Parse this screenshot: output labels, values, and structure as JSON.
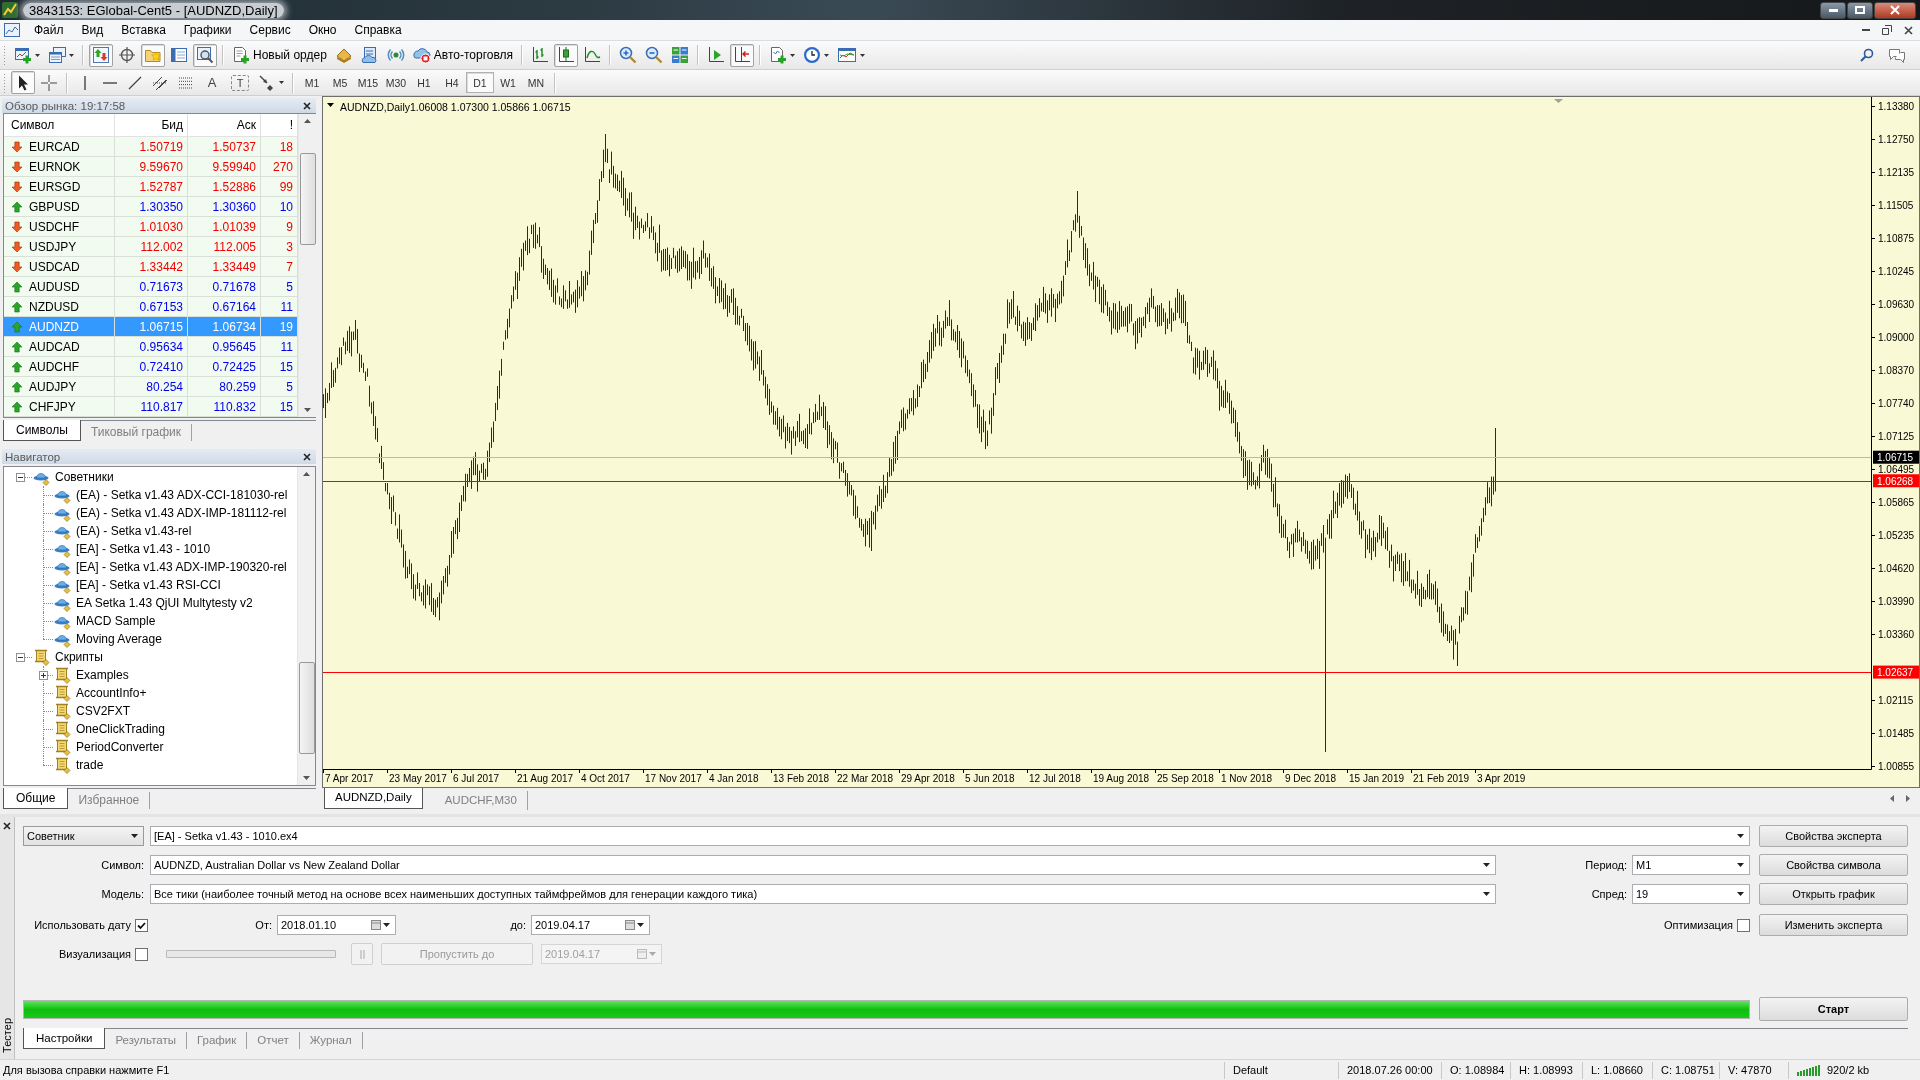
{
  "window": {
    "title": "3843153: EGlobal-Cent5 - [AUDNZD,Daily]"
  },
  "menu": [
    "Файл",
    "Вид",
    "Вставка",
    "Графики",
    "Сервис",
    "Окно",
    "Справка"
  ],
  "toolbar": [
    {
      "kind": "new-chart",
      "on": false
    },
    {
      "kind": "profiles",
      "on": false
    },
    {
      "kind": "separator"
    },
    {
      "kind": "market-watch",
      "on": true
    },
    {
      "kind": "data-window",
      "on": false
    },
    {
      "kind": "navigator",
      "on": true
    },
    {
      "kind": "terminal",
      "on": false
    },
    {
      "kind": "tester",
      "on": true
    },
    {
      "kind": "separator"
    },
    {
      "kind": "new-order",
      "label": "Новый ордер",
      "on": false
    },
    {
      "kind": "editor",
      "on": false
    },
    {
      "kind": "signals",
      "on": false
    },
    {
      "kind": "market",
      "on": false
    },
    {
      "kind": "auto-trading",
      "label": "Авто-торговля",
      "on": false
    },
    {
      "kind": "separator"
    },
    {
      "kind": "bar-chart",
      "on": false
    },
    {
      "kind": "candles",
      "on": true
    },
    {
      "kind": "line-chart",
      "on": false
    },
    {
      "kind": "separator"
    },
    {
      "kind": "zoom-in",
      "on": false
    },
    {
      "kind": "zoom-out",
      "on": false
    },
    {
      "kind": "tile",
      "on": false
    },
    {
      "kind": "separator"
    },
    {
      "kind": "auto-scroll",
      "on": false
    },
    {
      "kind": "chart-shift",
      "on": true
    },
    {
      "kind": "separator"
    },
    {
      "kind": "indicators",
      "on": false
    },
    {
      "kind": "periods",
      "on": false
    },
    {
      "kind": "templates",
      "on": false
    }
  ],
  "drawing_tools": [
    {
      "kind": "cursor",
      "on": true
    },
    {
      "kind": "crosshair",
      "on": false
    },
    {
      "kind": "separator"
    },
    {
      "kind": "vertical-line",
      "on": false
    },
    {
      "kind": "horizontal-line",
      "on": false
    },
    {
      "kind": "trend-line",
      "on": false
    },
    {
      "kind": "channel",
      "on": false
    },
    {
      "kind": "fibonacci",
      "on": false
    },
    {
      "kind": "text",
      "label": "A",
      "on": false
    },
    {
      "kind": "text-label",
      "label": "T",
      "on": false
    },
    {
      "kind": "arrows",
      "on": false
    }
  ],
  "periods": [
    {
      "label": "M1",
      "selected": false
    },
    {
      "label": "M5",
      "selected": false
    },
    {
      "label": "M15",
      "selected": false
    },
    {
      "label": "M30",
      "selected": false
    },
    {
      "label": "H1",
      "selected": false
    },
    {
      "label": "H4",
      "selected": false
    },
    {
      "label": "D1",
      "selected": true
    },
    {
      "label": "W1",
      "selected": false
    },
    {
      "label": "MN",
      "selected": false
    }
  ],
  "market_watch": {
    "title": "Обзор рынка: 19:17:58",
    "columns": [
      "Символ",
      "Бид",
      "Аск",
      "!"
    ],
    "rows": [
      {
        "symbol": "EURCAD",
        "bid": "1.50719",
        "ask": "1.50737",
        "spread": "18",
        "kind": "down",
        "selected": false
      },
      {
        "symbol": "EURNOK",
        "bid": "9.59670",
        "ask": "9.59940",
        "spread": "270",
        "kind": "down",
        "selected": false
      },
      {
        "symbol": "EURSGD",
        "bid": "1.52787",
        "ask": "1.52886",
        "spread": "99",
        "kind": "down",
        "selected": false
      },
      {
        "symbol": "GBPUSD",
        "bid": "1.30350",
        "ask": "1.30360",
        "spread": "10",
        "kind": "up",
        "selected": false
      },
      {
        "symbol": "USDCHF",
        "bid": "1.01030",
        "ask": "1.01039",
        "spread": "9",
        "kind": "down",
        "selected": false
      },
      {
        "symbol": "USDJPY",
        "bid": "112.002",
        "ask": "112.005",
        "spread": "3",
        "kind": "down",
        "selected": false
      },
      {
        "symbol": "USDCAD",
        "bid": "1.33442",
        "ask": "1.33449",
        "spread": "7",
        "kind": "down",
        "selected": false
      },
      {
        "symbol": "AUDUSD",
        "bid": "0.71673",
        "ask": "0.71678",
        "spread": "5",
        "kind": "up",
        "selected": false
      },
      {
        "symbol": "NZDUSD",
        "bid": "0.67153",
        "ask": "0.67164",
        "spread": "11",
        "kind": "up",
        "selected": false
      },
      {
        "symbol": "AUDNZD",
        "bid": "1.06715",
        "ask": "1.06734",
        "spread": "19",
        "kind": "up",
        "selected": true
      },
      {
        "symbol": "AUDCAD",
        "bid": "0.95634",
        "ask": "0.95645",
        "spread": "11",
        "kind": "up",
        "selected": false
      },
      {
        "symbol": "AUDCHF",
        "bid": "0.72410",
        "ask": "0.72425",
        "spread": "15",
        "kind": "up",
        "selected": false
      },
      {
        "symbol": "AUDJPY",
        "bid": "80.254",
        "ask": "80.259",
        "spread": "5",
        "kind": "up",
        "selected": false
      },
      {
        "symbol": "CHFJPY",
        "bid": "110.817",
        "ask": "110.832",
        "spread": "15",
        "kind": "up",
        "selected": false
      }
    ],
    "tabs": [
      {
        "label": "Символы",
        "selected": true
      },
      {
        "label": "Тиковый график",
        "selected": false
      }
    ]
  },
  "navigator": {
    "title": "Навигатор",
    "tree": [
      {
        "label": "Советники",
        "kind": "expert",
        "expanded": true,
        "children": [
          {
            "label": "(EA) - Setka v1.43 ADX-CCI-181030-rel",
            "kind": "expert"
          },
          {
            "label": "(EA) - Setka v1.43 ADX-IMP-181112-rel",
            "kind": "expert"
          },
          {
            "label": "(EA) - Setka v1.43-rel",
            "kind": "expert"
          },
          {
            "label": "[EA] - Setka v1.43 - 1010",
            "kind": "expert"
          },
          {
            "label": "[EA] - Setka v1.43 ADX-IMP-190320-rel",
            "kind": "expert"
          },
          {
            "label": "[EA] - Setka v1.43 RSI-CCI",
            "kind": "expert"
          },
          {
            "label": "EA Setka 1.43 QjUI Multytesty v2",
            "kind": "expert"
          },
          {
            "label": "MACD Sample",
            "kind": "expert"
          },
          {
            "label": "Moving Average",
            "kind": "expert"
          }
        ]
      },
      {
        "label": "Скрипты",
        "kind": "script",
        "expanded": true,
        "children": [
          {
            "label": "Examples",
            "kind": "script",
            "expanded": false
          },
          {
            "label": "AccountInfo+",
            "kind": "script"
          },
          {
            "label": "CSV2FXT",
            "kind": "script"
          },
          {
            "label": "OneClickTrading",
            "kind": "script"
          },
          {
            "label": "PeriodConverter",
            "kind": "script"
          },
          {
            "label": "trade",
            "kind": "script"
          }
        ]
      }
    ],
    "tabs": [
      {
        "label": "Общие",
        "selected": true
      },
      {
        "label": "Избранное",
        "selected": false
      }
    ]
  },
  "chart": {
    "symbol_label": "AUDNZD,Daily",
    "ohlc": "1.06008 1.07300 1.05866 1.06715",
    "price_ticks": [
      "1.13380",
      "1.12750",
      "1.12135",
      "1.11505",
      "1.10875",
      "1.10245",
      "1.09630",
      "1.09000",
      "1.08370",
      "1.07740",
      "1.07125",
      "1.06495",
      "1.05865",
      "1.05235",
      "1.04620",
      "1.03990",
      "1.03360",
      "1.02115",
      "1.01485",
      "1.00855"
    ],
    "date_ticks": [
      "7 Apr 2017",
      "23 May 2017",
      "6 Jul 2017",
      "21 Aug 2017",
      "4 Oct 2017",
      "17 Nov 2017",
      "4 Jan 2018",
      "13 Feb 2018",
      "22 Mar 2018",
      "29 Apr 2018",
      "5 Jun 2018",
      "12 Jul 2018",
      "19 Aug 2018",
      "25 Sep 2018",
      "1 Nov 2018",
      "9 Dec 2018",
      "15 Jan 2019",
      "21 Feb 2019",
      "3 Apr 2019"
    ],
    "price_lines": [
      {
        "label": "1.06715",
        "kind": "bid",
        "color": "#000000"
      },
      {
        "label": "1.06268",
        "kind": "level",
        "color": "#ff0000"
      },
      {
        "label": "1.02637",
        "kind": "level",
        "color": "#ff0000"
      }
    ],
    "tabs": [
      {
        "label": "AUDNZD,Daily",
        "selected": true
      },
      {
        "label": "AUDCHF,M30",
        "selected": false
      }
    ]
  },
  "tester": {
    "title": "Тестер",
    "mode": "Советник",
    "expert": "[EA] - Setka v1.43 - 1010.ex4",
    "symbol": {
      "label": "Символ:",
      "value": "AUDNZD, Australian Dollar vs New Zealand Dollar"
    },
    "model": {
      "label": "Модель:",
      "value": "Все тики (наиболее точный метод на основе всех наименьших доступных таймфреймов для генерации каждого тика)"
    },
    "period": {
      "label": "Период:",
      "value": "M1"
    },
    "spread": {
      "label": "Спред:",
      "value": "19"
    },
    "use_date": {
      "label": "Использовать дату",
      "checked": true
    },
    "from": {
      "label": "От:",
      "value": "2018.01.10"
    },
    "to": {
      "label": "до:",
      "value": "2019.04.17"
    },
    "optimization": {
      "label": "Оптимизация",
      "checked": false
    },
    "visualization": {
      "label": "Визуализация",
      "checked": false
    },
    "pause": {
      "disabled": true
    },
    "skip": {
      "label": "Пропустить до",
      "disabled": true
    },
    "skip_date": {
      "value": "2019.04.17",
      "disabled": true
    },
    "buttons": [
      "Свойства эксперта",
      "Свойства символа",
      "Открыть график",
      "Изменить эксперта"
    ],
    "progress": {
      "level": 1
    },
    "start": "Старт",
    "tabs": [
      {
        "label": "Настройки",
        "selected": true
      },
      {
        "label": "Результаты",
        "selected": false
      },
      {
        "label": "График",
        "selected": false
      },
      {
        "label": "Отчет",
        "selected": false
      },
      {
        "label": "Журнал",
        "selected": false
      }
    ]
  },
  "status_bar": {
    "help": "Для вызова справки нажмите F1",
    "fields": [
      "Default",
      "2018.07.26 00:00",
      "O: 1.08984",
      "H: 1.08993",
      "L: 1.08660",
      "C: 1.08751",
      "V: 47870"
    ],
    "traffic": "920/2 kb"
  }
}
